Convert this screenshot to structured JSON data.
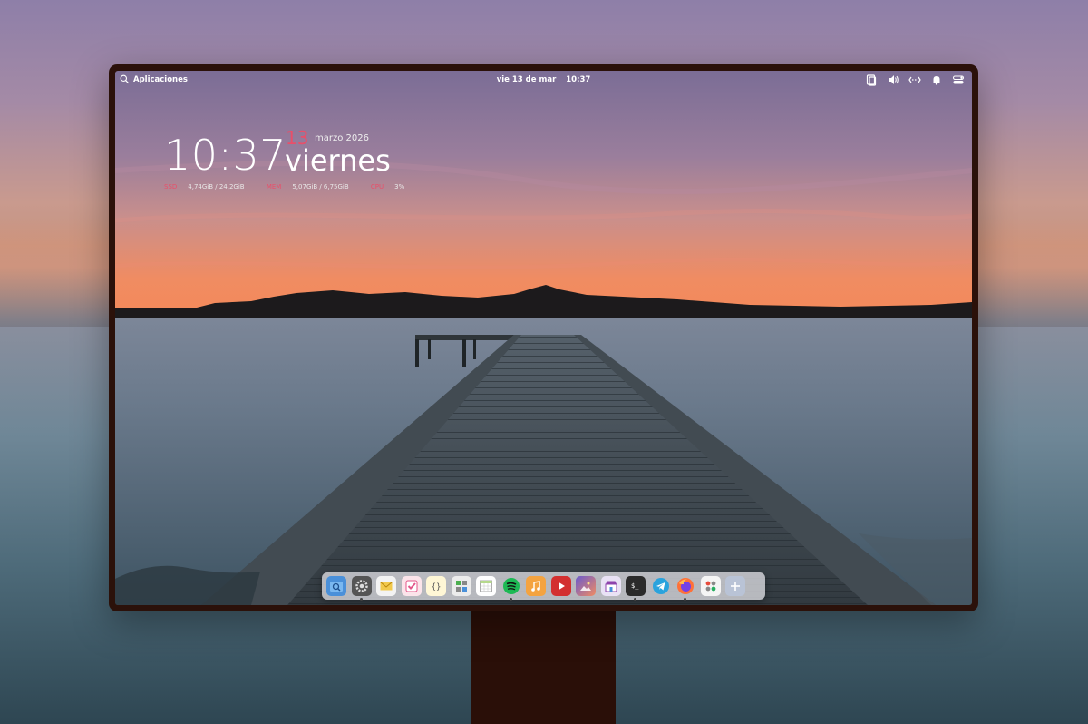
{
  "topbar": {
    "apps_label": "Aplicaciones",
    "date": "vie 13 de mar",
    "time": "10:37",
    "indicators": [
      "clipboard-icon",
      "volume-icon",
      "network-icon",
      "notification-bell-icon",
      "session-toggle-icon"
    ]
  },
  "widget": {
    "time": "10:37",
    "day": "13",
    "month_year": "marzo 2026",
    "weekday": "viernes",
    "stats": [
      {
        "key": "SSD",
        "value": "4,74GiB / 24,2GiB"
      },
      {
        "key": "MEM",
        "value": "5,07GiB / 6,75GiB"
      },
      {
        "key": "CPU",
        "value": "3%"
      }
    ]
  },
  "dock": {
    "apps": [
      {
        "name": "files",
        "icon": "folder-search-icon",
        "running": false
      },
      {
        "name": "settings",
        "icon": "gear-icon",
        "running": true
      },
      {
        "name": "mail",
        "icon": "mail-icon",
        "running": false
      },
      {
        "name": "tasks",
        "icon": "checkbox-icon",
        "running": false
      },
      {
        "name": "code",
        "icon": "code-braces-icon",
        "running": false
      },
      {
        "name": "calculator",
        "icon": "calculator-icon",
        "running": false
      },
      {
        "name": "calendar",
        "icon": "calendar-icon",
        "running": false
      },
      {
        "name": "spotify",
        "icon": "spotify-icon",
        "running": true
      },
      {
        "name": "music",
        "icon": "music-note-icon",
        "running": false
      },
      {
        "name": "videos",
        "icon": "play-icon",
        "running": false
      },
      {
        "name": "photos",
        "icon": "photo-icon",
        "running": false
      },
      {
        "name": "app-center",
        "icon": "store-icon",
        "running": false
      },
      {
        "name": "terminal",
        "icon": "terminal-icon",
        "running": true
      },
      {
        "name": "telegram",
        "icon": "telegram-icon",
        "running": false
      },
      {
        "name": "firefox",
        "icon": "firefox-icon",
        "running": true
      },
      {
        "name": "system-monitor",
        "icon": "grid-icon",
        "running": false
      },
      {
        "name": "add",
        "icon": "plus-icon",
        "running": false
      }
    ]
  },
  "colors": {
    "accent": "#e94f6a",
    "frame": "#2b110a"
  }
}
